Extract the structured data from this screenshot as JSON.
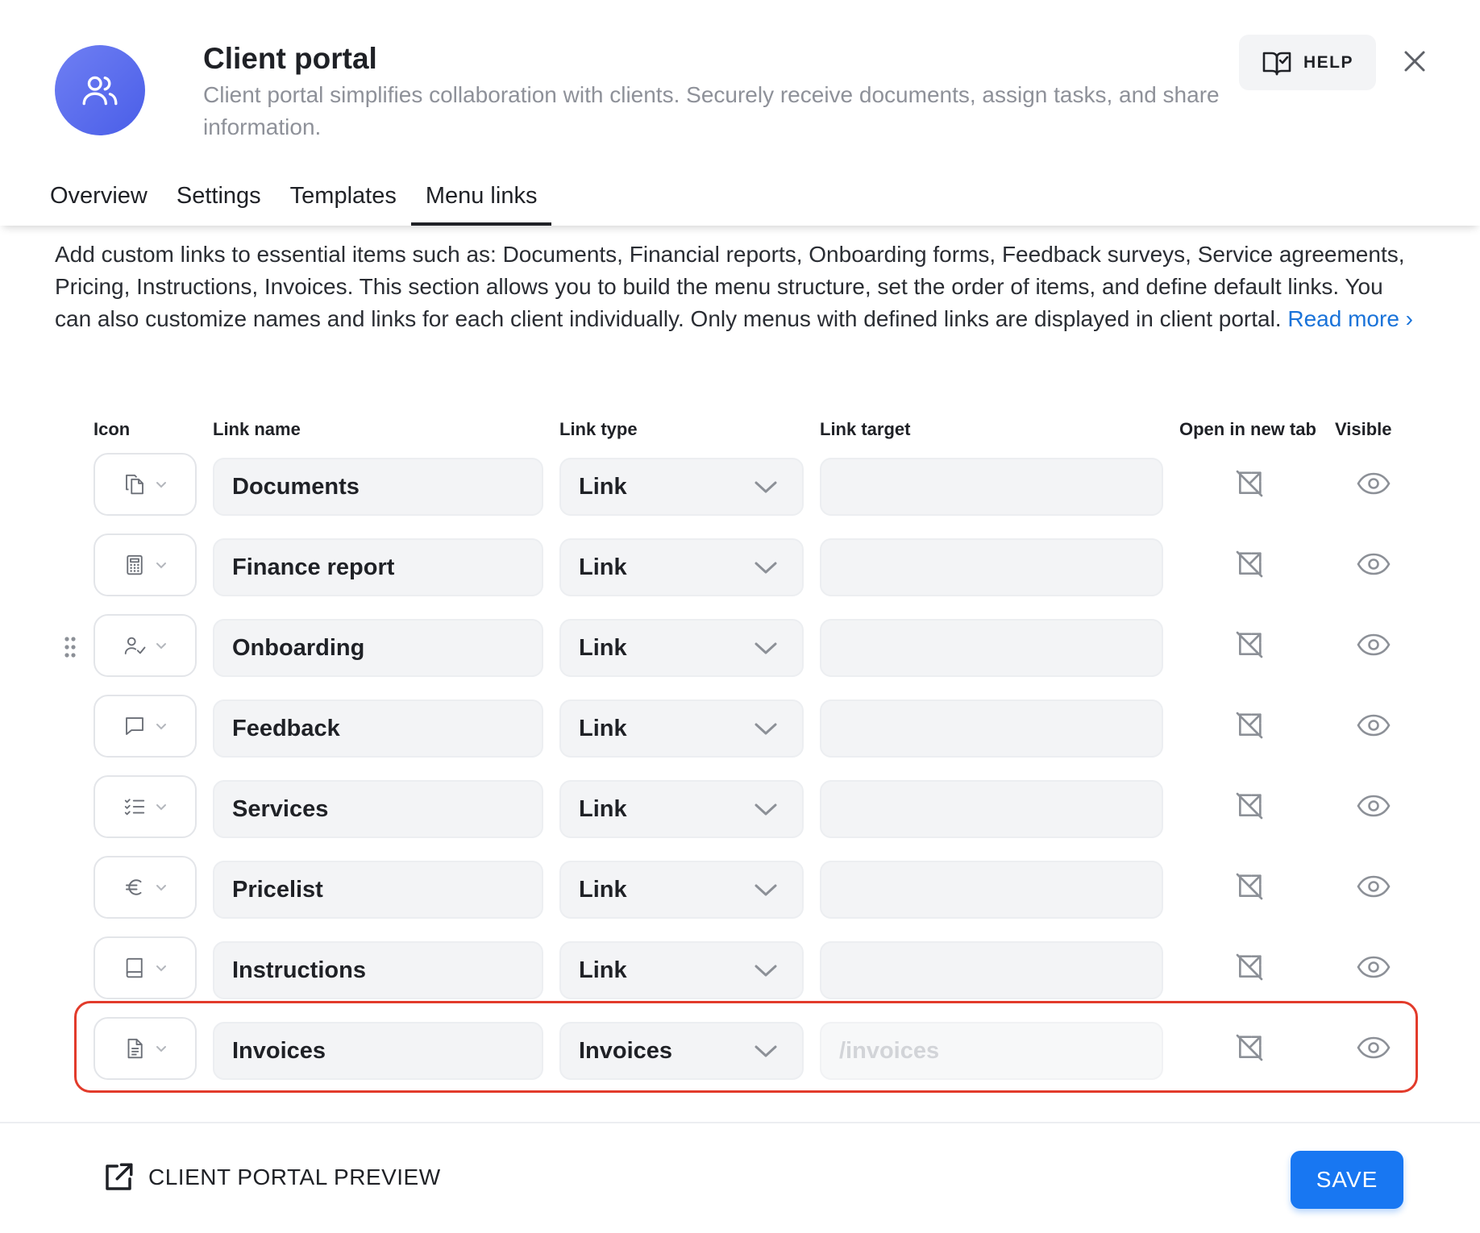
{
  "header": {
    "title": "Client portal",
    "subtitle": "Client portal simplifies collaboration with clients. Securely receive documents, assign tasks, and share information.",
    "help_label": "HELP"
  },
  "tabs": [
    {
      "label": "Overview"
    },
    {
      "label": "Settings"
    },
    {
      "label": "Templates"
    },
    {
      "label": "Menu links",
      "active": true
    }
  ],
  "description": {
    "text": "Add custom links to essential items such as: Documents, Financial reports, Onboarding forms, Feedback surveys, Service agreements, Pricing, Instructions, Invoices. This section allows you to build the menu structure, set the order of items, and define default links. You can also customize names and links for each client individually. Only menus with defined links are displayed in client portal. ",
    "read_more": "Read more ›"
  },
  "columns": {
    "icon": "Icon",
    "link_name": "Link name",
    "link_type": "Link type",
    "link_target": "Link target",
    "open_new_tab": "Open in new tab",
    "visible": "Visible"
  },
  "rows": [
    {
      "icon": "documents-icon",
      "name": "Documents",
      "type": "Link",
      "target": ""
    },
    {
      "icon": "calculator-icon",
      "name": "Finance report",
      "type": "Link",
      "target": ""
    },
    {
      "icon": "user-check-icon",
      "name": "Onboarding",
      "type": "Link",
      "target": ""
    },
    {
      "icon": "message-icon",
      "name": "Feedback",
      "type": "Link",
      "target": ""
    },
    {
      "icon": "checklist-icon",
      "name": "Services",
      "type": "Link",
      "target": ""
    },
    {
      "icon": "euro-icon",
      "name": "Pricelist",
      "type": "Link",
      "target": ""
    },
    {
      "icon": "book-icon",
      "name": "Instructions",
      "type": "Link",
      "target": ""
    },
    {
      "icon": "file-text-icon",
      "name": "Invoices",
      "type": "Invoices",
      "target": "/invoices"
    }
  ],
  "footer": {
    "preview_label": "CLIENT PORTAL PREVIEW",
    "save_label": "SAVE"
  },
  "colors": {
    "accent": "#1877f2",
    "avatar": "#5667ec",
    "highlight": "#e23b2b",
    "link": "#1a73d9"
  }
}
